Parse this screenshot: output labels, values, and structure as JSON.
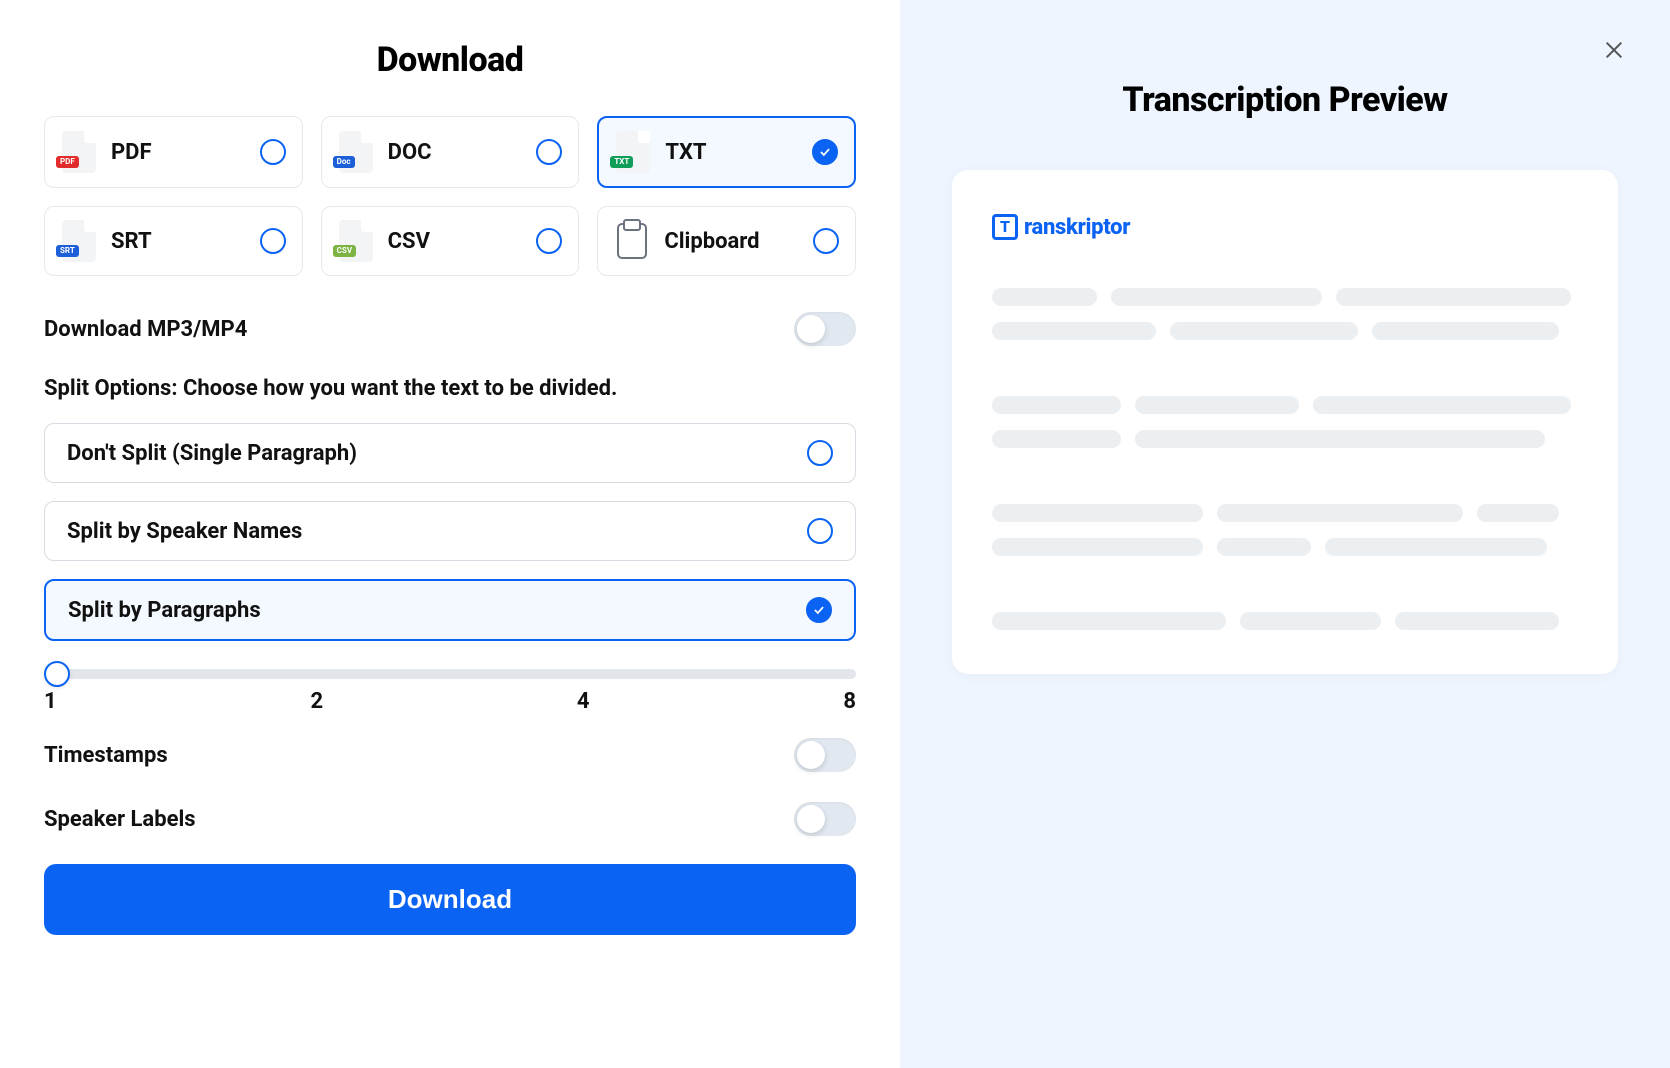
{
  "title": "Download",
  "preview_title": "Transcription Preview",
  "brand": {
    "icon_letter": "T",
    "name": "ranskriptor"
  },
  "formats": [
    {
      "key": "pdf",
      "label": "PDF",
      "tag": "PDF",
      "tag_color": "#e22b2b",
      "selected": false
    },
    {
      "key": "doc",
      "label": "DOC",
      "tag": "Doc",
      "tag_color": "#1d5fd8",
      "selected": false
    },
    {
      "key": "txt",
      "label": "TXT",
      "tag": "TXT",
      "tag_color": "#0f9d58",
      "selected": true
    },
    {
      "key": "srt",
      "label": "SRT",
      "tag": "SRT",
      "tag_color": "#1d5fd8",
      "selected": false
    },
    {
      "key": "csv",
      "label": "CSV",
      "tag": "CSV",
      "tag_color": "#7cb342",
      "selected": false
    },
    {
      "key": "clipboard",
      "label": "Clipboard",
      "tag": "",
      "tag_color": "",
      "selected": false,
      "clipboard": true
    }
  ],
  "mp3_label": "Download MP3/MP4",
  "mp3_on": false,
  "split_label": "Split Options: Choose how you want the text to be divided.",
  "split_options": [
    {
      "label": "Don't Split (Single Paragraph)",
      "selected": false
    },
    {
      "label": "Split by Speaker Names",
      "selected": false
    },
    {
      "label": "Split by Paragraphs",
      "selected": true
    }
  ],
  "slider": {
    "value": 1,
    "ticks": [
      "1",
      "2",
      "4",
      "8"
    ]
  },
  "timestamps_label": "Timestamps",
  "timestamps_on": false,
  "speaker_labels_label": "Speaker Labels",
  "speaker_labels_on": false,
  "download_button": "Download"
}
